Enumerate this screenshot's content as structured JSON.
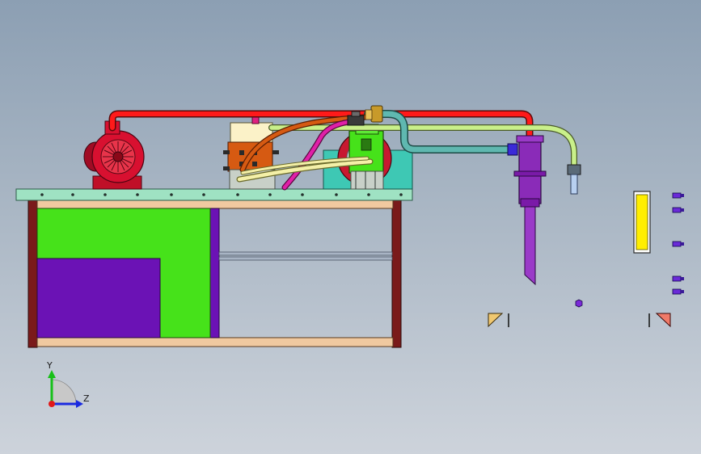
{
  "triad": {
    "y_label": "Y",
    "z_label": "Z"
  },
  "colors": {
    "background_top": "#8c9fb3",
    "background_bottom": "#cdd3db",
    "table_top": "#9fe2c3",
    "tank_green": "#46e21a",
    "tank_purple": "#6b12b5",
    "pipe_red": "#ff1a1a",
    "pipe_lightgreen": "#c9f08a",
    "pipe_teal": "#5fb8b0",
    "hose_orange": "#d65a12",
    "hose_magenta": "#e020a8",
    "pump_red": "#d81030",
    "nozzle_purple": "#8a2bb8",
    "gauge_yellow": "#ffee00",
    "frame_brown": "#7a1a1a"
  }
}
